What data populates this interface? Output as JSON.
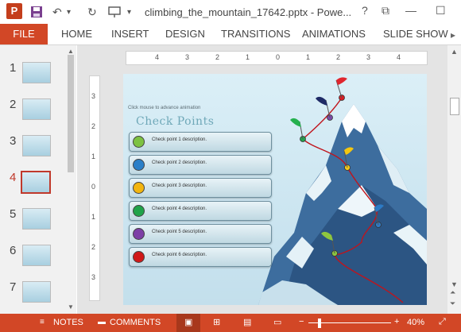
{
  "app": {
    "logo_letter": "P",
    "title": "climbing_the_mountain_17642.pptx - Powe...",
    "window_controls": [
      "?",
      "⧉",
      "—",
      "☐"
    ]
  },
  "ribbon": {
    "file": "FILE",
    "tabs": [
      "HOME",
      "INSERT",
      "DESIGN",
      "TRANSITIONS",
      "ANIMATIONS",
      "SLIDE SHOW"
    ]
  },
  "slides_panel": {
    "numbers": [
      "1",
      "2",
      "3",
      "4",
      "5",
      "6",
      "7"
    ],
    "selected": "4"
  },
  "ruler": {
    "h_labels": [
      "4",
      "3",
      "2",
      "1",
      "0",
      "1",
      "2",
      "3",
      "4"
    ],
    "v_labels": [
      "3",
      "2",
      "1",
      "0",
      "1",
      "2",
      "3"
    ]
  },
  "slide": {
    "hint": "Click mouse to advance animation",
    "heading": "Check Points",
    "checkpoints": [
      {
        "label": "Check point 1 description.",
        "color": "#7dc242"
      },
      {
        "label": "Check point 2 description.",
        "color": "#2a7fc8"
      },
      {
        "label": "Check point 3 description.",
        "color": "#f2b50f"
      },
      {
        "label": "Check point 4 description.",
        "color": "#20a34a"
      },
      {
        "label": "Check point 5 description.",
        "color": "#7d3fa6"
      },
      {
        "label": "Check point 6 description.",
        "color": "#d01919"
      }
    ]
  },
  "status_bar": {
    "notes": "NOTES",
    "comments": "COMMENTS",
    "zoom": "40%"
  },
  "colors": {
    "accent": "#d24726"
  }
}
